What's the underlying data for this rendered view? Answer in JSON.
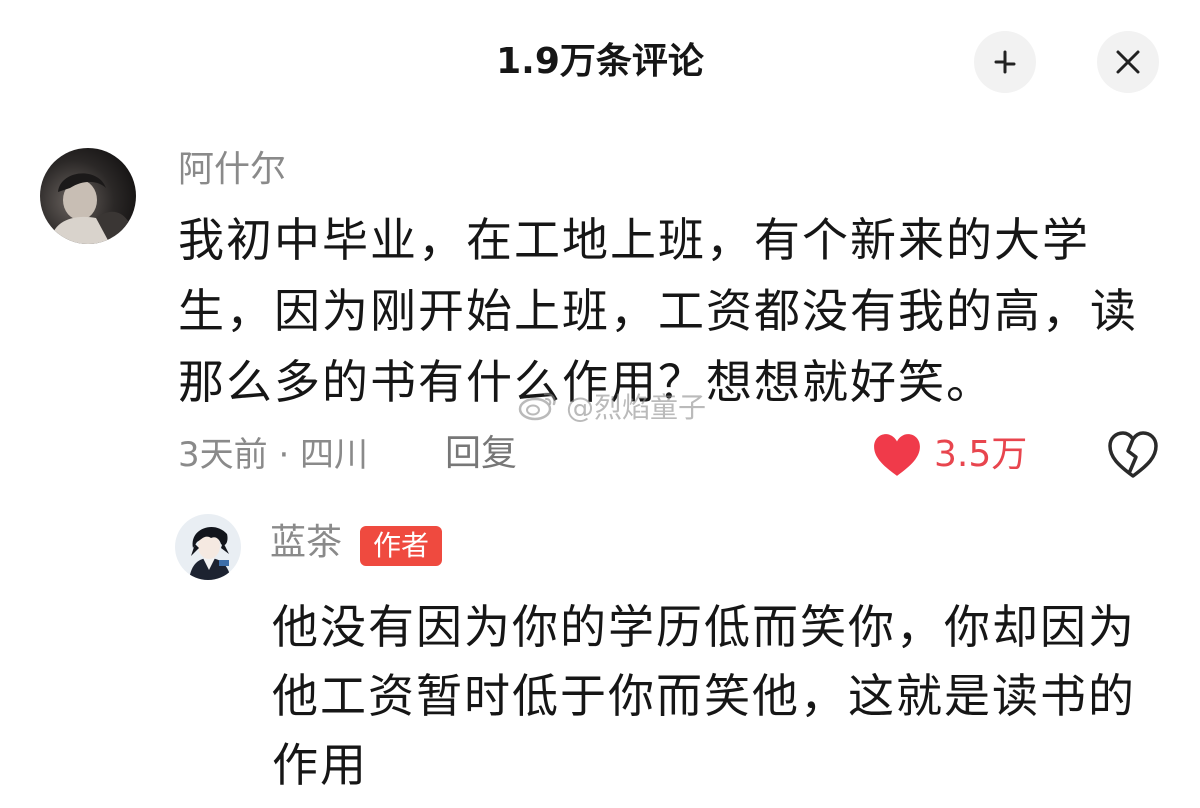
{
  "header": {
    "title": "1.9万条评论",
    "collapse_icon": "collapse-icon",
    "close_icon": "close-icon"
  },
  "comment": {
    "username": "阿什尔",
    "avatar_icon": "user-avatar-photo",
    "lines": [
      "我初中毕业，在工地上班，有个新来的大学",
      "生，因为刚开始上班，工资都没有我的高，读",
      "那么多的书有什么作用？想想就好笑。"
    ],
    "time_location": "3天前 · 四川",
    "reply_label": "回复",
    "like_count": "3.5万",
    "liked": true,
    "like_icon": "heart-filled-icon",
    "dislike_icon": "broken-heart-icon"
  },
  "reply": {
    "username": "蓝茶",
    "avatar_icon": "anime-avatar",
    "badge": "作者",
    "lines": [
      "他没有因为你的学历低而笑你，你却因为",
      "他工资暂时低于你而笑他，这就是读书的",
      "作用"
    ]
  },
  "watermark": {
    "text": "@烈焰童子",
    "icon": "weibo-icon"
  },
  "colors": {
    "text_dark": "#161616",
    "meta_gray": "#8a8a8a",
    "like_red": "#f03a4a",
    "badge_red": "#ef4a3f",
    "button_bg": "#f2f2f2"
  }
}
